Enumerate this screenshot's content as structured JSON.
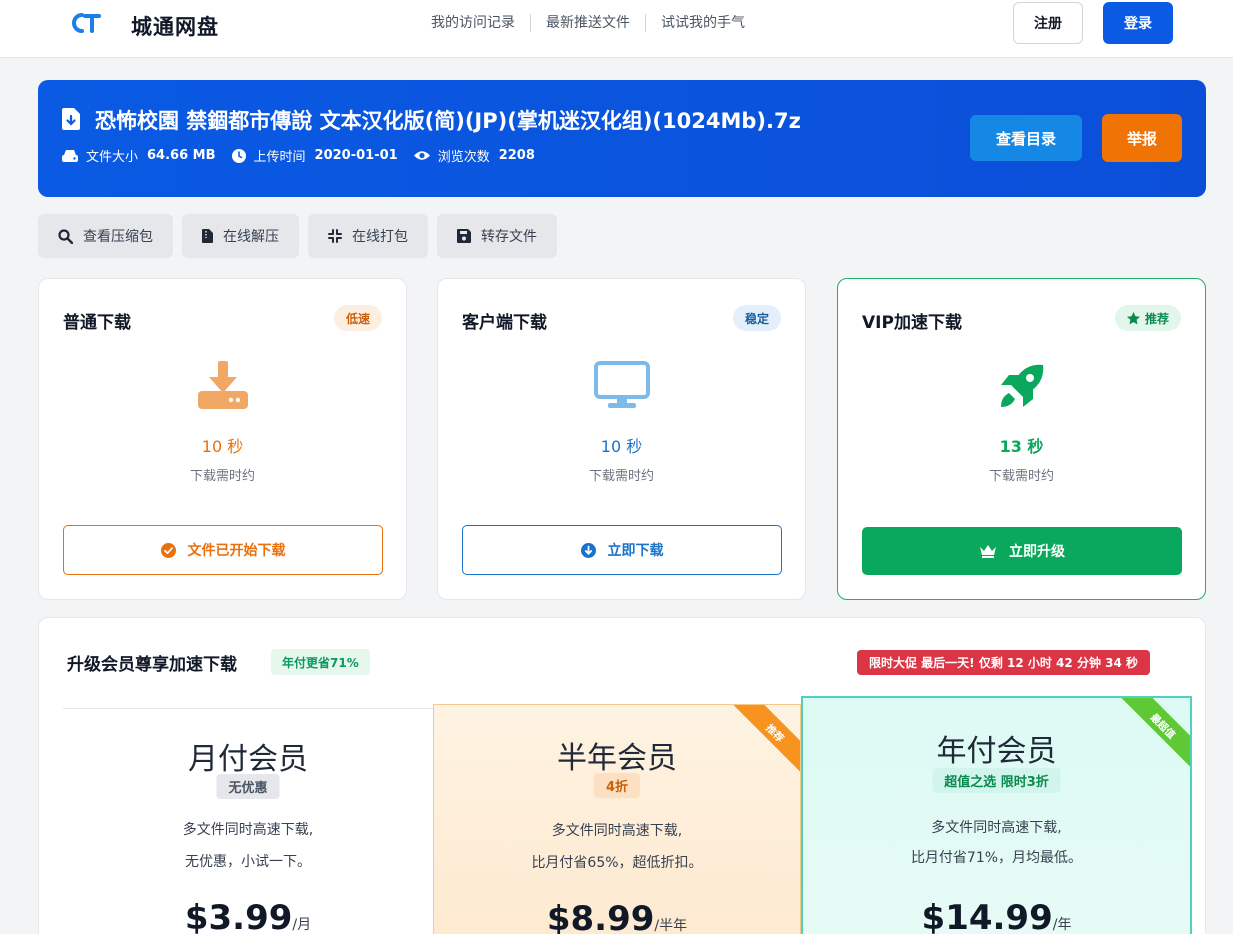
{
  "nav": {
    "brand": "城通网盘",
    "links": [
      "我的访问记录",
      "最新推送文件",
      "试试我的手气"
    ],
    "register": "注册",
    "login": "登录"
  },
  "file": {
    "title": "恐怖校園 禁錮都市傳說 文本汉化版(简)(JP)(掌机迷汉化组)(1024Mb).7z",
    "size_label": "文件大小",
    "size": "64.66 MB",
    "date_label": "上传时间",
    "date": "2020-01-01",
    "views_label": "浏览次数",
    "views": "2208",
    "dir_button": "查看目录",
    "report_button": "举报"
  },
  "tools": [
    "查看压缩包",
    "在线解压",
    "在线打包",
    "转存文件"
  ],
  "downloads": [
    {
      "title": "普通下载",
      "badge": "低速",
      "seconds": "10 秒",
      "label": "下载需时约",
      "action": "文件已开始下载",
      "color": "#e8700d"
    },
    {
      "title": "客户端下载",
      "badge": "稳定",
      "seconds": "10 秒",
      "label": "下载需时约",
      "action": "立即下载",
      "color": "#1a73c9"
    },
    {
      "title": "VIP加速下载",
      "badge": "推荐",
      "seconds": "13 秒",
      "label": "下载需时约",
      "action": "立即升级",
      "color": "#0aa85c"
    }
  ],
  "upgrade": {
    "title": "升级会员尊享加速下载",
    "tag": "年付更省71%",
    "promo": "限时大促 最后一天! 仅剩 12 小时 42 分钟 34 秒",
    "plans": [
      {
        "name": "月付会员",
        "badge": "无优惠",
        "desc1": "多文件同时高速下载,",
        "desc2": "无优惠，小试一下。",
        "price": "$3.99",
        "unit": "/月",
        "ribbon": ""
      },
      {
        "name": "半年会员",
        "badge": "4折",
        "desc1": "多文件同时高速下载,",
        "desc2": "比月付省65%，超低折扣。",
        "price": "$8.99",
        "unit": "/半年",
        "ribbon": "推荐"
      },
      {
        "name": "年付会员",
        "badge": "超值之选 限时3折",
        "desc1": "多文件同时高速下载,",
        "desc2": "比月付省71%，月均最低。",
        "price": "$14.99",
        "unit": "/年",
        "ribbon": "最超值"
      }
    ]
  }
}
